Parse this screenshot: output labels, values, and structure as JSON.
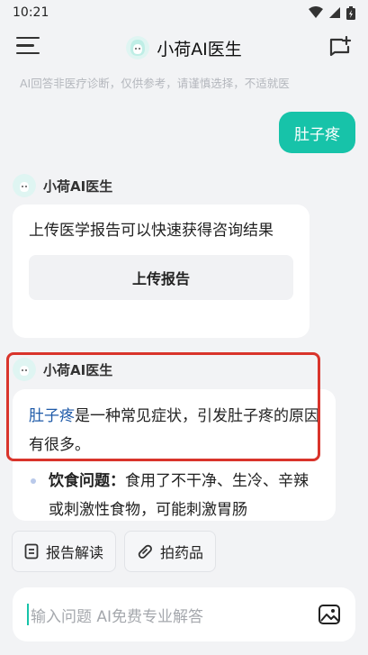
{
  "status_bar": {
    "time": "10:21"
  },
  "header": {
    "title": "小荷AI医生"
  },
  "disclaimer": "AI回答非医疗诊断，仅供参考，请谨慎选择，不适就医",
  "user_message": "肚子疼",
  "bot_name": "小荷AI医生",
  "card1": {
    "text": "上传医学报告可以快速获得咨询结果",
    "button": "上传报告"
  },
  "card2": {
    "link": "肚子疼",
    "text_rest": "是一种常见症状，引发肚子疼的原因有很多。",
    "bullet_title": "饮食问题：",
    "bullet_text": "食用了不干净、生冷、辛辣或刺激性食物，可能刺激胃肠"
  },
  "chips": [
    {
      "label": "报告解读",
      "icon": "report-icon"
    },
    {
      "label": "拍药品",
      "icon": "link-icon"
    }
  ],
  "input": {
    "placeholder": "输入问题 AI免费专业解答"
  },
  "colors": {
    "accent": "#17c3a9",
    "highlight": "#d9342b",
    "link": "#1e5aa8"
  }
}
